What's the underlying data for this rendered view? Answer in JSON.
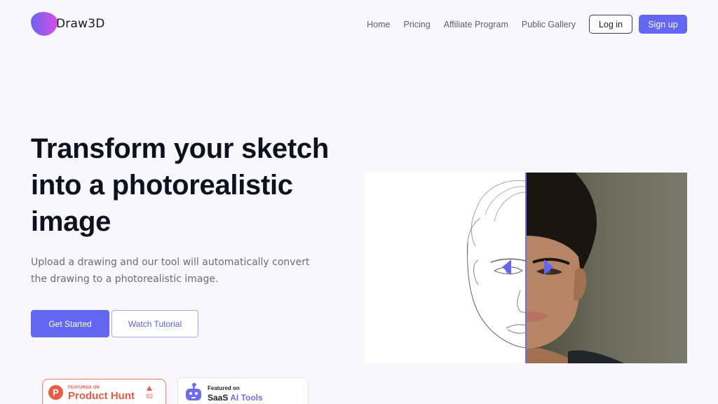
{
  "brand": {
    "name": "Draw3D",
    "gradient": [
      "#6b63f0",
      "#d94ee6"
    ]
  },
  "nav": {
    "links": [
      "Home",
      "Pricing",
      "Affiliate Program",
      "Public Gallery"
    ],
    "login_label": "Log in",
    "signup_label": "Sign up"
  },
  "hero": {
    "title": "Transform your sketch into a photorealistic image",
    "subtitle": "Upload a drawing and our tool will automatically convert the drawing to a photorealistic image.",
    "primary_cta": "Get Started",
    "secondary_cta": "Watch Tutorial"
  },
  "badges": {
    "product_hunt": {
      "small": "FEATURED ON",
      "big": "Product Hunt",
      "votes": "92",
      "color": "#ea5a47"
    },
    "saas": {
      "small": "Featured on",
      "big_prefix": "SaaS",
      "big_accent": "AI Tools",
      "accent_color": "#6c6cf0"
    }
  },
  "comparison": {
    "before_label": "sketch drawing of face",
    "after_label": "photorealistic portrait",
    "slider_position_percent": 50,
    "accent_color": "#6366f1"
  }
}
